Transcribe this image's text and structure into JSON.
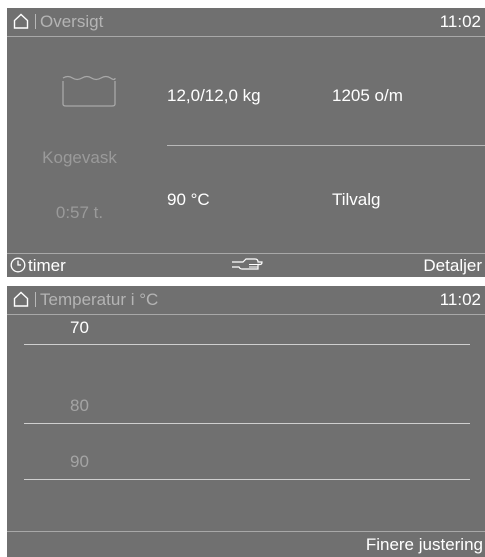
{
  "overview": {
    "header": {
      "title": "Oversigt",
      "time": "11:02"
    },
    "program": {
      "name": "Kogevask",
      "duration": "0:57  t.",
      "icon": "wash-tub-icon"
    },
    "load": "12,0/12,0  kg",
    "spin": "1205 o/m",
    "temperature": "90 °C",
    "extras": "Tilvalg",
    "footer": {
      "timer_label": "timer",
      "details_label": "Detaljer"
    }
  },
  "temperature_menu": {
    "header": {
      "title": "Temperatur i °C",
      "time": "11:02"
    },
    "options": [
      {
        "label": "70",
        "selected": true
      },
      {
        "label": "80",
        "selected": false
      },
      {
        "label": "90",
        "selected": false
      }
    ],
    "footer": {
      "fine_adjust_label": "Finere justering"
    }
  },
  "colors": {
    "screen_bg": "#707070",
    "active_text": "#ffffff",
    "inactive_text": "#b4b4b4"
  }
}
